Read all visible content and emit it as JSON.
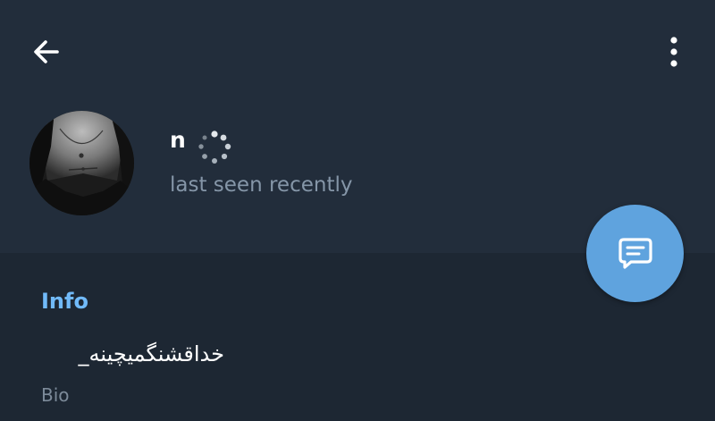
{
  "header": {
    "back_icon": "arrow-left-icon",
    "menu_icon": "more-vertical-icon",
    "user": {
      "name": "n",
      "status": "last seen recently",
      "avatar": "profile-photo"
    }
  },
  "fab": {
    "icon": "message-icon"
  },
  "info": {
    "section_title": "Info",
    "bio": {
      "value": "خداقشنگمیچینه_",
      "label": "Bio"
    }
  },
  "colors": {
    "header_bg": "#222d3b",
    "body_bg": "#1d2733",
    "accent": "#71baf9",
    "fab": "#5fa3de",
    "muted_text": "#8596a8"
  }
}
